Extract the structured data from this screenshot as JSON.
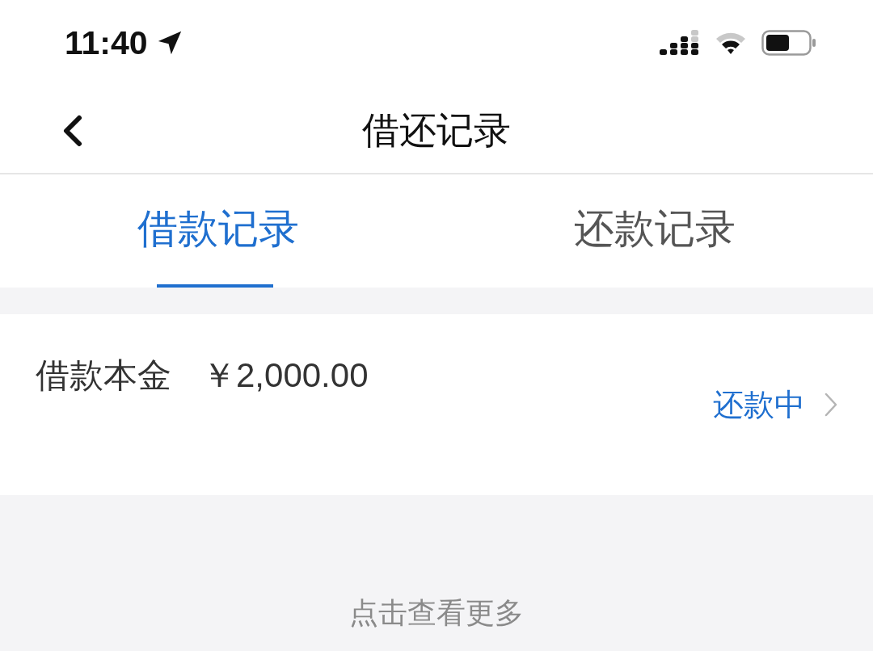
{
  "status_bar": {
    "time": "11:40"
  },
  "nav": {
    "title": "借还记录"
  },
  "tabs": [
    {
      "label": "借款记录",
      "selected": true
    },
    {
      "label": "还款记录",
      "selected": false
    }
  ],
  "records": [
    {
      "label": "借款本金",
      "amount": "￥2,000.00",
      "status": "还款中"
    }
  ],
  "more": "点击查看更多"
}
